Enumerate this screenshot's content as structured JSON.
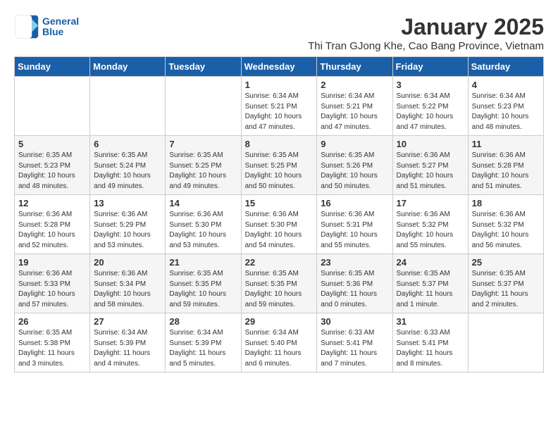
{
  "header": {
    "logo_line1": "General",
    "logo_line2": "Blue",
    "main_title": "January 2025",
    "subtitle": "Thi Tran GJong Khe, Cao Bang Province, Vietnam"
  },
  "weekdays": [
    "Sunday",
    "Monday",
    "Tuesday",
    "Wednesday",
    "Thursday",
    "Friday",
    "Saturday"
  ],
  "weeks": [
    [
      {
        "day": "",
        "info": ""
      },
      {
        "day": "",
        "info": ""
      },
      {
        "day": "",
        "info": ""
      },
      {
        "day": "1",
        "info": "Sunrise: 6:34 AM\nSunset: 5:21 PM\nDaylight: 10 hours and 47 minutes."
      },
      {
        "day": "2",
        "info": "Sunrise: 6:34 AM\nSunset: 5:21 PM\nDaylight: 10 hours and 47 minutes."
      },
      {
        "day": "3",
        "info": "Sunrise: 6:34 AM\nSunset: 5:22 PM\nDaylight: 10 hours and 47 minutes."
      },
      {
        "day": "4",
        "info": "Sunrise: 6:34 AM\nSunset: 5:23 PM\nDaylight: 10 hours and 48 minutes."
      }
    ],
    [
      {
        "day": "5",
        "info": "Sunrise: 6:35 AM\nSunset: 5:23 PM\nDaylight: 10 hours and 48 minutes."
      },
      {
        "day": "6",
        "info": "Sunrise: 6:35 AM\nSunset: 5:24 PM\nDaylight: 10 hours and 49 minutes."
      },
      {
        "day": "7",
        "info": "Sunrise: 6:35 AM\nSunset: 5:25 PM\nDaylight: 10 hours and 49 minutes."
      },
      {
        "day": "8",
        "info": "Sunrise: 6:35 AM\nSunset: 5:25 PM\nDaylight: 10 hours and 50 minutes."
      },
      {
        "day": "9",
        "info": "Sunrise: 6:35 AM\nSunset: 5:26 PM\nDaylight: 10 hours and 50 minutes."
      },
      {
        "day": "10",
        "info": "Sunrise: 6:36 AM\nSunset: 5:27 PM\nDaylight: 10 hours and 51 minutes."
      },
      {
        "day": "11",
        "info": "Sunrise: 6:36 AM\nSunset: 5:28 PM\nDaylight: 10 hours and 51 minutes."
      }
    ],
    [
      {
        "day": "12",
        "info": "Sunrise: 6:36 AM\nSunset: 5:28 PM\nDaylight: 10 hours and 52 minutes."
      },
      {
        "day": "13",
        "info": "Sunrise: 6:36 AM\nSunset: 5:29 PM\nDaylight: 10 hours and 53 minutes."
      },
      {
        "day": "14",
        "info": "Sunrise: 6:36 AM\nSunset: 5:30 PM\nDaylight: 10 hours and 53 minutes."
      },
      {
        "day": "15",
        "info": "Sunrise: 6:36 AM\nSunset: 5:30 PM\nDaylight: 10 hours and 54 minutes."
      },
      {
        "day": "16",
        "info": "Sunrise: 6:36 AM\nSunset: 5:31 PM\nDaylight: 10 hours and 55 minutes."
      },
      {
        "day": "17",
        "info": "Sunrise: 6:36 AM\nSunset: 5:32 PM\nDaylight: 10 hours and 55 minutes."
      },
      {
        "day": "18",
        "info": "Sunrise: 6:36 AM\nSunset: 5:32 PM\nDaylight: 10 hours and 56 minutes."
      }
    ],
    [
      {
        "day": "19",
        "info": "Sunrise: 6:36 AM\nSunset: 5:33 PM\nDaylight: 10 hours and 57 minutes."
      },
      {
        "day": "20",
        "info": "Sunrise: 6:36 AM\nSunset: 5:34 PM\nDaylight: 10 hours and 58 minutes."
      },
      {
        "day": "21",
        "info": "Sunrise: 6:35 AM\nSunset: 5:35 PM\nDaylight: 10 hours and 59 minutes."
      },
      {
        "day": "22",
        "info": "Sunrise: 6:35 AM\nSunset: 5:35 PM\nDaylight: 10 hours and 59 minutes."
      },
      {
        "day": "23",
        "info": "Sunrise: 6:35 AM\nSunset: 5:36 PM\nDaylight: 11 hours and 0 minutes."
      },
      {
        "day": "24",
        "info": "Sunrise: 6:35 AM\nSunset: 5:37 PM\nDaylight: 11 hours and 1 minute."
      },
      {
        "day": "25",
        "info": "Sunrise: 6:35 AM\nSunset: 5:37 PM\nDaylight: 11 hours and 2 minutes."
      }
    ],
    [
      {
        "day": "26",
        "info": "Sunrise: 6:35 AM\nSunset: 5:38 PM\nDaylight: 11 hours and 3 minutes."
      },
      {
        "day": "27",
        "info": "Sunrise: 6:34 AM\nSunset: 5:39 PM\nDaylight: 11 hours and 4 minutes."
      },
      {
        "day": "28",
        "info": "Sunrise: 6:34 AM\nSunset: 5:39 PM\nDaylight: 11 hours and 5 minutes."
      },
      {
        "day": "29",
        "info": "Sunrise: 6:34 AM\nSunset: 5:40 PM\nDaylight: 11 hours and 6 minutes."
      },
      {
        "day": "30",
        "info": "Sunrise: 6:33 AM\nSunset: 5:41 PM\nDaylight: 11 hours and 7 minutes."
      },
      {
        "day": "31",
        "info": "Sunrise: 6:33 AM\nSunset: 5:41 PM\nDaylight: 11 hours and 8 minutes."
      },
      {
        "day": "",
        "info": ""
      }
    ]
  ]
}
